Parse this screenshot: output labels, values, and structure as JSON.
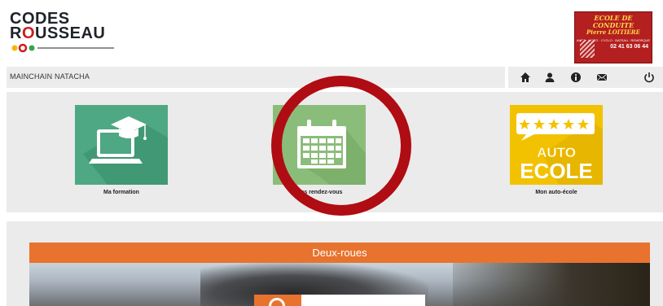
{
  "logo": {
    "line1": "CODES",
    "line2_r": "R",
    "line2_o": "O",
    "line2_rest": "USSEAU"
  },
  "badge": {
    "title": "ECOLE DE CONDUITE",
    "name": "Pierre LOITIERE",
    "services": "AUTO · MOTO · CYCLO · BATEAU · REMORQUE",
    "phone": "02 41 63 06 44"
  },
  "topbar": {
    "user_name": "MAINCHAIN NATACHA"
  },
  "icons": [
    "home-icon",
    "user-icon",
    "info-icon",
    "mail-icon",
    "power-icon"
  ],
  "tiles": [
    {
      "id": "formation",
      "label": "Ma formation",
      "color": "#4ea884"
    },
    {
      "id": "rdv",
      "label": "Mes rendez-vous",
      "color": "#8bbd7a"
    },
    {
      "id": "auto",
      "label": "Mon auto-école",
      "color": "#f2c200"
    }
  ],
  "auto_tile": {
    "line1": "AUTO",
    "line2": "ECOLE"
  },
  "section": {
    "title": "Deux-roues"
  },
  "colors": {
    "accent_orange": "#e8732e",
    "highlight_red": "#b00c13"
  }
}
